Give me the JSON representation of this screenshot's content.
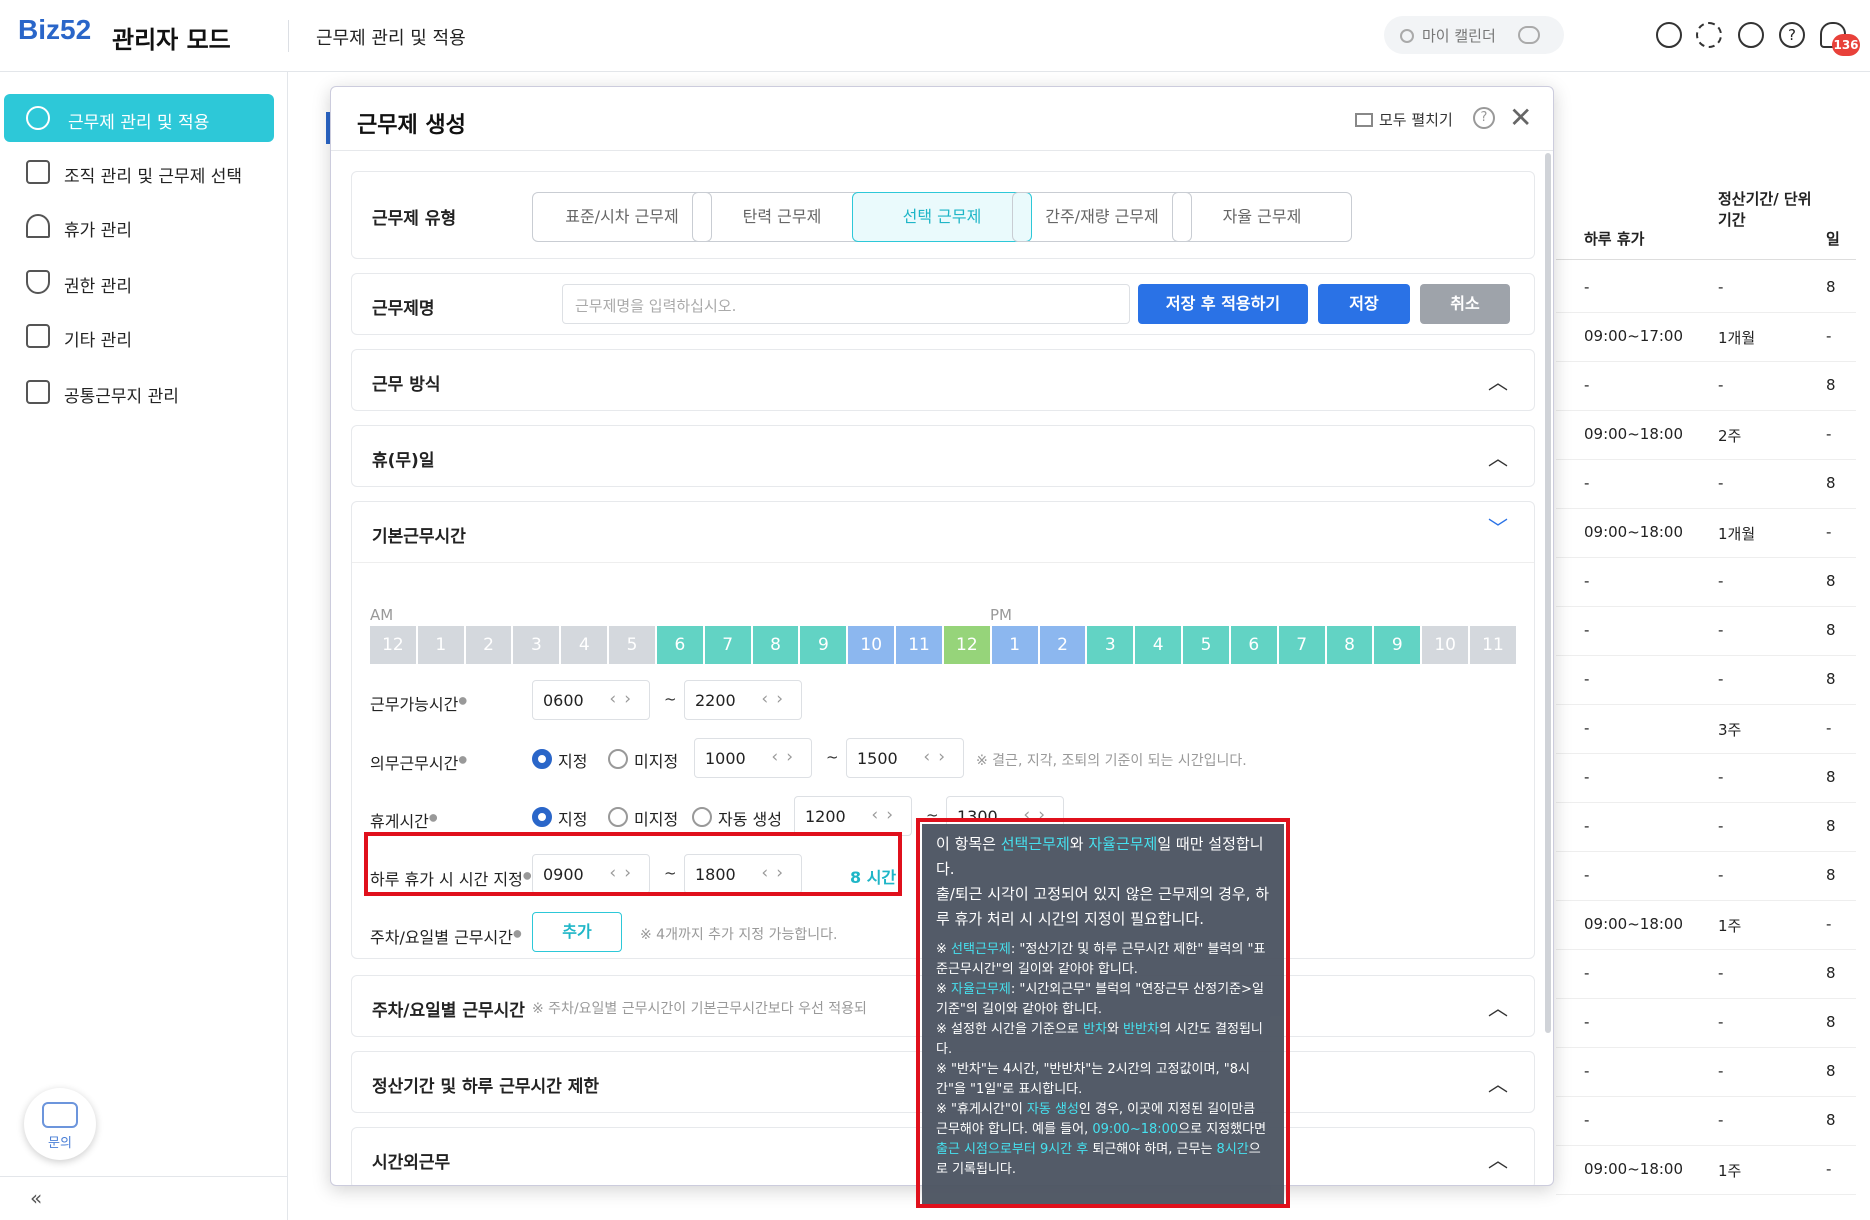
{
  "header": {
    "logo": "Biz52",
    "title": "관리자 모드",
    "breadcrumb": "근무제 관리 및 적용",
    "my_calendar": "마이 캘린더",
    "notification_count": "136"
  },
  "sidebar": {
    "items": [
      {
        "label": "근무제 관리 및 적용",
        "icon": "clock-icon",
        "active": true
      },
      {
        "label": "조직 관리 및 근무제 선택",
        "icon": "org-chart-icon"
      },
      {
        "label": "휴가 관리",
        "icon": "umbrella-icon"
      },
      {
        "label": "권한 관리",
        "icon": "shield-icon"
      },
      {
        "label": "기타 관리",
        "icon": "grid-icon"
      },
      {
        "label": "공통근무지 관리",
        "icon": "building-icon"
      }
    ],
    "chat_label": "문의",
    "collapse": "«"
  },
  "background_table": {
    "headers": [
      "하루 휴가",
      "정산기간/ 단위기간",
      "일"
    ],
    "rows": [
      [
        "-",
        "-",
        "8"
      ],
      [
        "09:00~17:00",
        "1개월",
        "-"
      ],
      [
        "-",
        "-",
        "8"
      ],
      [
        "09:00~18:00",
        "2주",
        "-"
      ],
      [
        "-",
        "-",
        "8"
      ],
      [
        "09:00~18:00",
        "1개월",
        "-"
      ],
      [
        "-",
        "-",
        "8"
      ],
      [
        "-",
        "-",
        "8"
      ],
      [
        "-",
        "-",
        "8"
      ],
      [
        "-",
        "3주",
        "-"
      ],
      [
        "-",
        "-",
        "8"
      ],
      [
        "-",
        "-",
        "8"
      ],
      [
        "-",
        "-",
        "8"
      ],
      [
        "09:00~18:00",
        "1주",
        "-"
      ],
      [
        "-",
        "-",
        "8"
      ],
      [
        "-",
        "-",
        "8"
      ],
      [
        "-",
        "-",
        "8"
      ],
      [
        "-",
        "-",
        "8"
      ],
      [
        "09:00~18:00",
        "1주",
        "-"
      ]
    ]
  },
  "modal": {
    "title": "근무제 생성",
    "expand_all": "모두 펼치기",
    "help": "?",
    "close": "✕",
    "type_label": "근무제 유형",
    "types": [
      "표준/시차 근무제",
      "탄력 근무제",
      "선택 근무제",
      "간주/재량 근무제",
      "자율 근무제"
    ],
    "selected_type": "선택 근무제",
    "name_label": "근무제명",
    "name_placeholder": "근무제명을 입력하십시오.",
    "save_apply": "저장 후 적용하기",
    "save": "저장",
    "cancel": "취소",
    "sections": {
      "work_method": "근무 방식",
      "holiday": "휴(무)일",
      "base_hours": "기본근무시간",
      "weekly": "주차/요일별 근무시간",
      "weekly_note": "※ 주차/요일별 근무시간이 기본근무시간보다 우선 적용되",
      "settlement": "정산기간 및 하루 근무시간 제한",
      "overtime": "시간외근무"
    },
    "timeline": {
      "am": "AM",
      "pm": "PM",
      "hours": [
        "12",
        "1",
        "2",
        "3",
        "4",
        "5",
        "6",
        "7",
        "8",
        "9",
        "10",
        "11",
        "12",
        "1",
        "2",
        "3",
        "4",
        "5",
        "6",
        "7",
        "8",
        "9",
        "10",
        "11"
      ],
      "colors": [
        "#d4d8dd",
        "#d4d8dd",
        "#d4d8dd",
        "#d4d8dd",
        "#d4d8dd",
        "#d4d8dd",
        "#62d3c4",
        "#62d3c4",
        "#62d3c4",
        "#62d3c4",
        "#8cb7ef",
        "#8cb7ef",
        "#96d47a",
        "#8cb7ef",
        "#8cb7ef",
        "#62d3c4",
        "#62d3c4",
        "#62d3c4",
        "#62d3c4",
        "#62d3c4",
        "#62d3c4",
        "#62d3c4",
        "#d4d8dd",
        "#d4d8dd"
      ]
    },
    "available": {
      "label": "근무가능시간",
      "start": "0600",
      "end": "2200"
    },
    "core": {
      "label": "의무근무시간",
      "opt1": "지정",
      "opt2": "미지정",
      "start": "1000",
      "end": "1500",
      "note": "※ 결근, 지각, 조퇴의 기준이 되는 시간입니다."
    },
    "break": {
      "label": "휴게시간",
      "opt1": "지정",
      "opt2": "미지정",
      "opt3": "자동 생성",
      "start": "1200",
      "end": "1300"
    },
    "dayoff": {
      "label": "하루 휴가 시 시간 지정",
      "start": "0900",
      "end": "1800",
      "hours": "8 시간"
    },
    "weekly_field": {
      "label": "주차/요일별 근무시간",
      "add": "추가",
      "note": "※ 4개까지 추가 지정 가능합니다."
    },
    "tilde": "~"
  },
  "tooltip": {
    "l1a": "이 항목은 ",
    "l1b": "선택근무제",
    "l1c": "와 ",
    "l1d": "자율근무제",
    "l1e": "일 때만 설정합니다.",
    "l2": "출/퇴근 시각이 고정되어 있지 않은 근무제의 경우, 하루 휴가 처리 시 시간의 지정이 필요합니다.",
    "n1a": "※ ",
    "n1b": "선택근무제",
    "n1c": ": \"정산기간 및 하루 근무시간 제한\" 블럭의 \"표준근무시간\"의 길이와 같아야 합니다.",
    "n2b": "자율근무제",
    "n2c": ": \"시간외근무\" 블럭의 \"연장근무 산정기준>일 기준\"의 길이와 같아야 합니다.",
    "n3a": "※ 설정한 시간을 기준으로 ",
    "n3b": "반차",
    "n3c": "와 ",
    "n3d": "반반차",
    "n3e": "의 시간도 결정됩니다.",
    "n4": "※ \"반차\"는 4시간, \"반반차\"는 2시간의 고정값이며, \"8시간\"을 \"1일\"로 표시합니다.",
    "n5a": "※ \"휴게시간\"이 ",
    "n5b": "자동 생성",
    "n5c": "인 경우, 이곳에 지정된 길이만큼 근무해야 합니다. 예를 들어, ",
    "n5d": "09:00~18:00",
    "n5e": "으로 지정했다면 ",
    "n5f": "출근 시점으로부터 9시간 후",
    "n5g": " 퇴근해야 하며, 근무는 ",
    "n5h": "8시간",
    "n5i": "으로 기록됩니다."
  }
}
